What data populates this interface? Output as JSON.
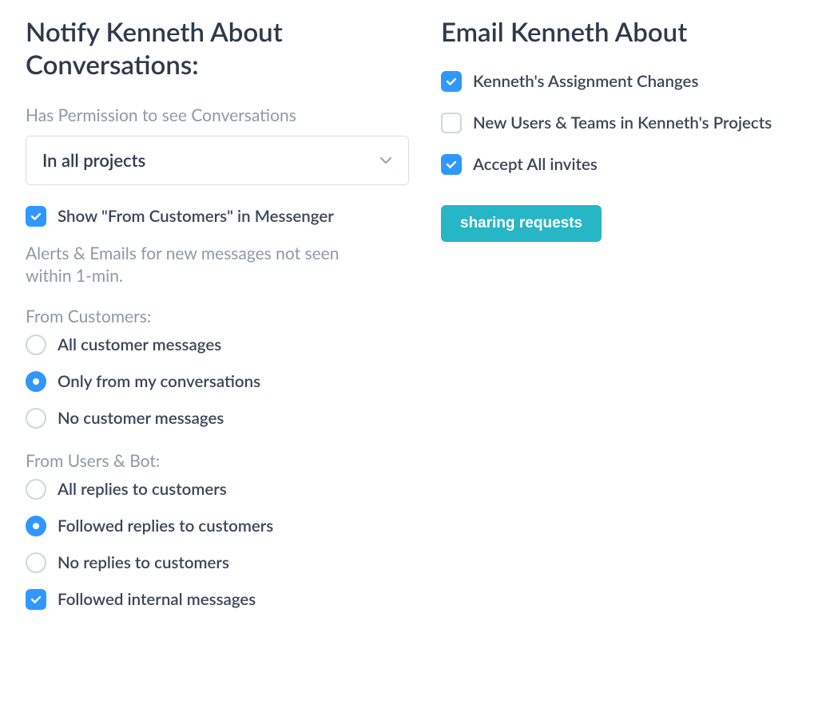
{
  "left": {
    "title": "Notify Kenneth About Conversations:",
    "permission_label": "Has Permission to see Conversations",
    "permission_value": "In all projects",
    "show_from_customers_label": "Show \"From Customers\" in Messenger",
    "show_from_customers_checked": true,
    "alerts_heading": "Alerts & Emails for new messages not seen within 1-min.",
    "from_customers_label": "From Customers:",
    "from_customers_options": [
      {
        "label": "All customer messages",
        "selected": false
      },
      {
        "label": "Only from my conversations",
        "selected": true
      },
      {
        "label": "No customer messages",
        "selected": false
      }
    ],
    "from_users_bot_label": "From Users & Bot:",
    "from_users_bot_options": [
      {
        "label": "All replies to customers",
        "selected": false
      },
      {
        "label": "Followed replies to customers",
        "selected": true
      },
      {
        "label": "No replies to customers",
        "selected": false
      }
    ],
    "followed_internal_label": "Followed internal messages",
    "followed_internal_checked": true
  },
  "right": {
    "title": "Email Kenneth About",
    "options": [
      {
        "label": "Kenneth's Assignment Changes",
        "checked": true
      },
      {
        "label": "New Users & Teams in Kenneth's Projects",
        "checked": false
      },
      {
        "label": "Accept All invites",
        "checked": true
      }
    ],
    "sharing_button": "sharing requests"
  }
}
